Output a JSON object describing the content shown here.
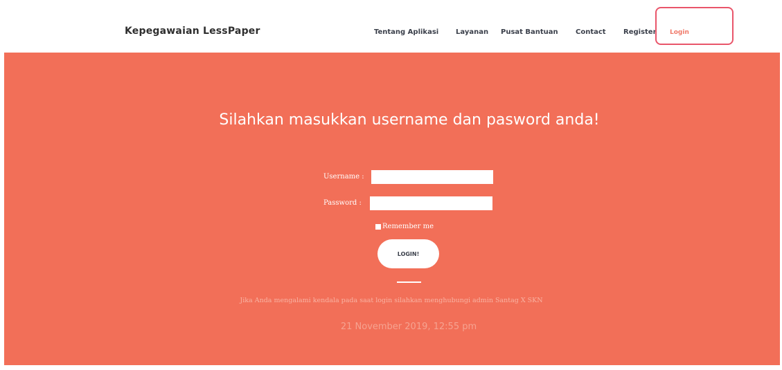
{
  "brand": {
    "name": "Kepegawaian LessPaper"
  },
  "nav": {
    "items": [
      {
        "label": "Tentang Aplikasi"
      },
      {
        "label": "Layanan"
      },
      {
        "label": "Pusat Bantuan"
      },
      {
        "label": "Contact"
      },
      {
        "label": "Register"
      }
    ],
    "login_label": "Login"
  },
  "login_form": {
    "title": "Silahkan masukkan username dan pasword anda!",
    "username_label": "Username :",
    "username_value": "",
    "password_label": "Password :",
    "password_value": "",
    "remember_label": "Remember me",
    "submit_label": "LOGIN!"
  },
  "help_text": "Jika Anda mengalami kendala pada saat login silahkan menghubungi admin Santag X SKN",
  "datetime": "21 November 2019, 12:55 pm",
  "colors": {
    "hero_background": "#f26f58",
    "login_highlight": "#e9556a",
    "nav_text": "#3a3f4a"
  }
}
